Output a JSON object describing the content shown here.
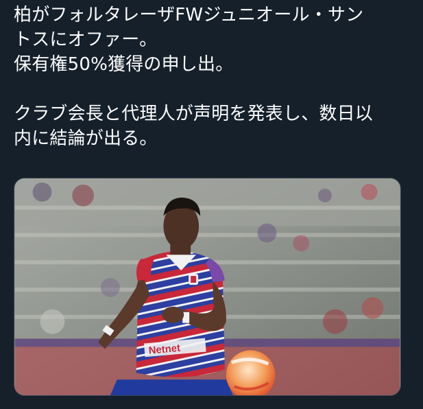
{
  "tweet": {
    "lines": [
      "柏がフォルタレーザFWジュニオール・サン",
      "トスにオファー。",
      "保有権50%獲得の申し出。",
      "",
      "クラブ会長と代理人が声明を発表し、数日以",
      "内に結論が出る。"
    ],
    "photo": {
      "alt": "Soccer player in red, blue and white striped kit running with ball",
      "sponsor_text": "Netnet",
      "jersey_colors": [
        "#c8283a",
        "#2d3fa0",
        "#f2f2f2"
      ]
    }
  },
  "colors": {
    "background": "#15202b",
    "text": "#ffffff",
    "border": "#38444d"
  }
}
